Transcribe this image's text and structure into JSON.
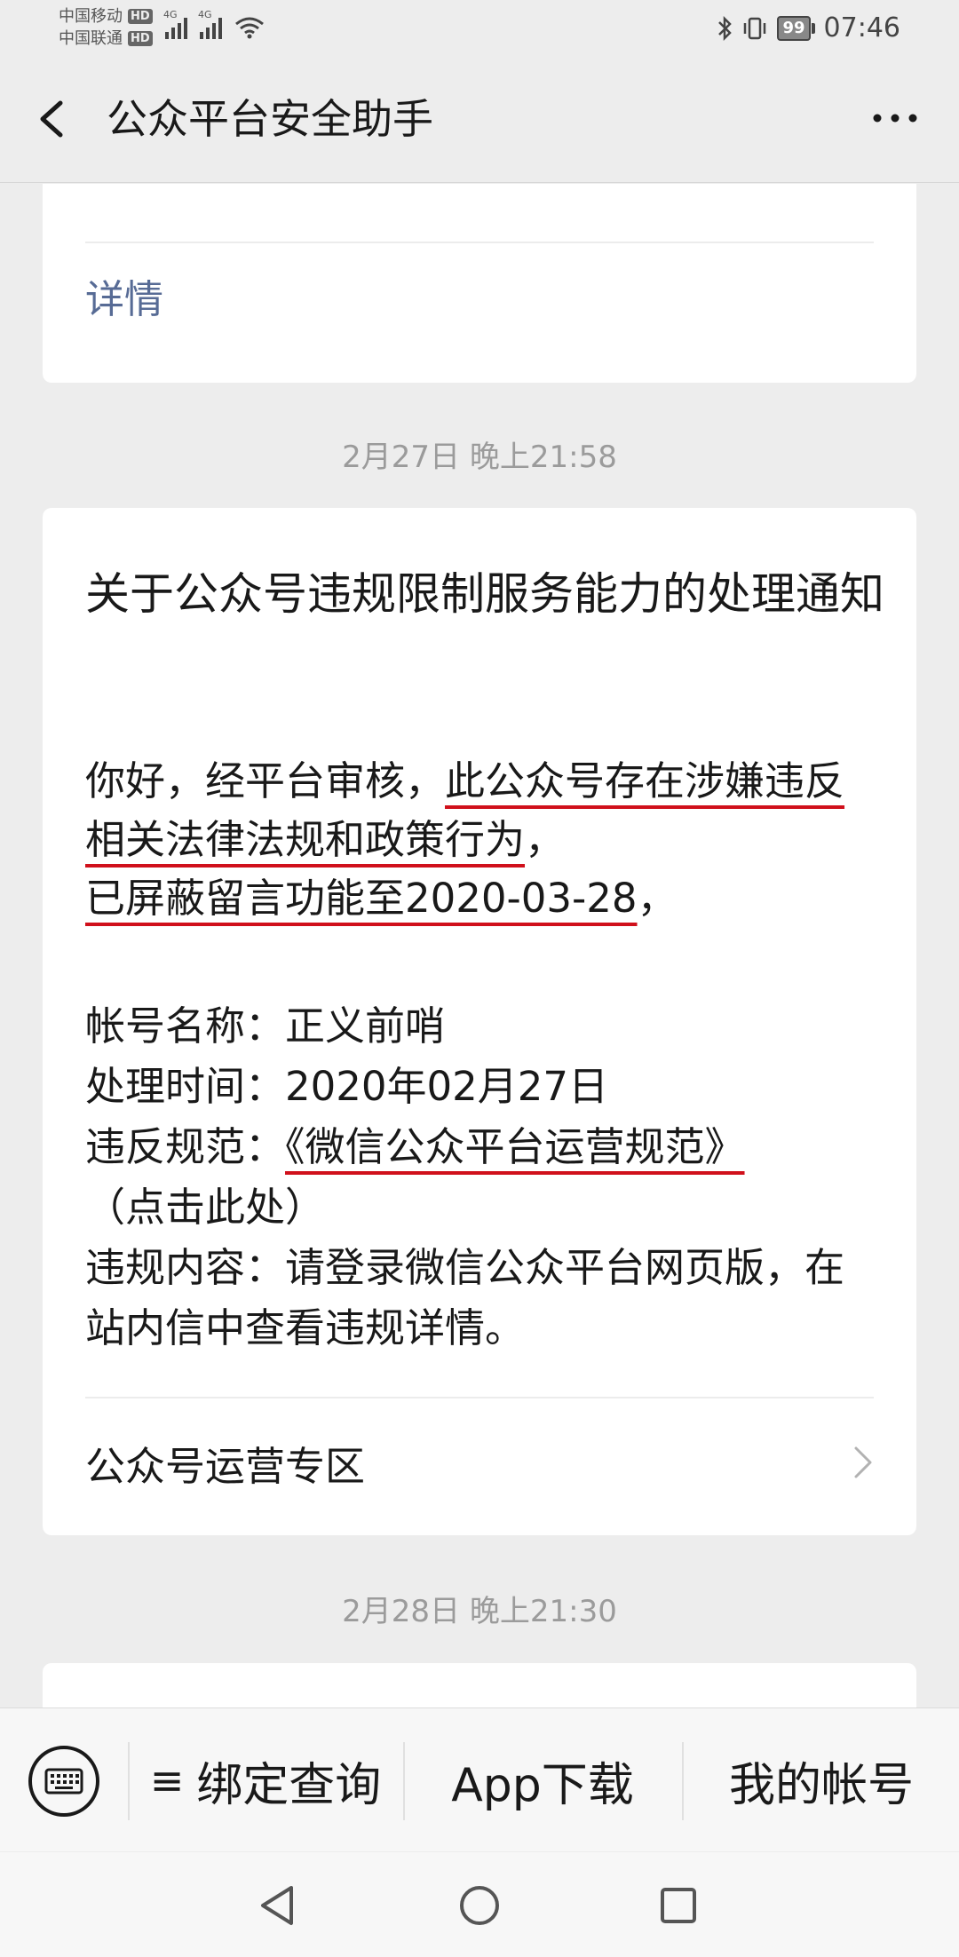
{
  "status_bar": {
    "carrier_1": "中国移动",
    "carrier_2": "中国联通",
    "hd_badge": "HD",
    "network_label": "4G",
    "battery": "99",
    "time": "07:46"
  },
  "header": {
    "title": "公众平台安全助手"
  },
  "messages": {
    "prev_card": {
      "link": "详情"
    },
    "time_1": "2月27日 晚上21:58",
    "notice": {
      "title": "关于公众号违规限制服务能力的处理通知",
      "body_prefix": "你好，经平台审核，",
      "body_highlight_1": "此公众号存在涉嫌违反相关法律法规和政策行为",
      "body_comma_1": "，",
      "body_highlight_2": "已屏蔽留言功能至2020-03-28",
      "body_comma_2": "，",
      "account_label": "帐号名称：",
      "account_value": "正义前哨",
      "time_label": "处理时间：",
      "time_value": "2020年02月27日",
      "spec_label": "违反规范：",
      "spec_link": "《微信公众平台运营规范》",
      "spec_suffix": "（点击此处）",
      "content_label": "违规内容：",
      "content_value": "请登录微信公众平台网页版，在站内信中查看违规详情。",
      "zone_link": "公众号运营专区"
    },
    "time_2": "2月28日 晚上21:30"
  },
  "menu": {
    "item_1_glyph": "≡",
    "item_1": "绑定查询",
    "item_2": "App下载",
    "item_3": "我的帐号"
  },
  "colors": {
    "link": "#576b95",
    "underline": "#d0101b",
    "background": "#ededed"
  }
}
